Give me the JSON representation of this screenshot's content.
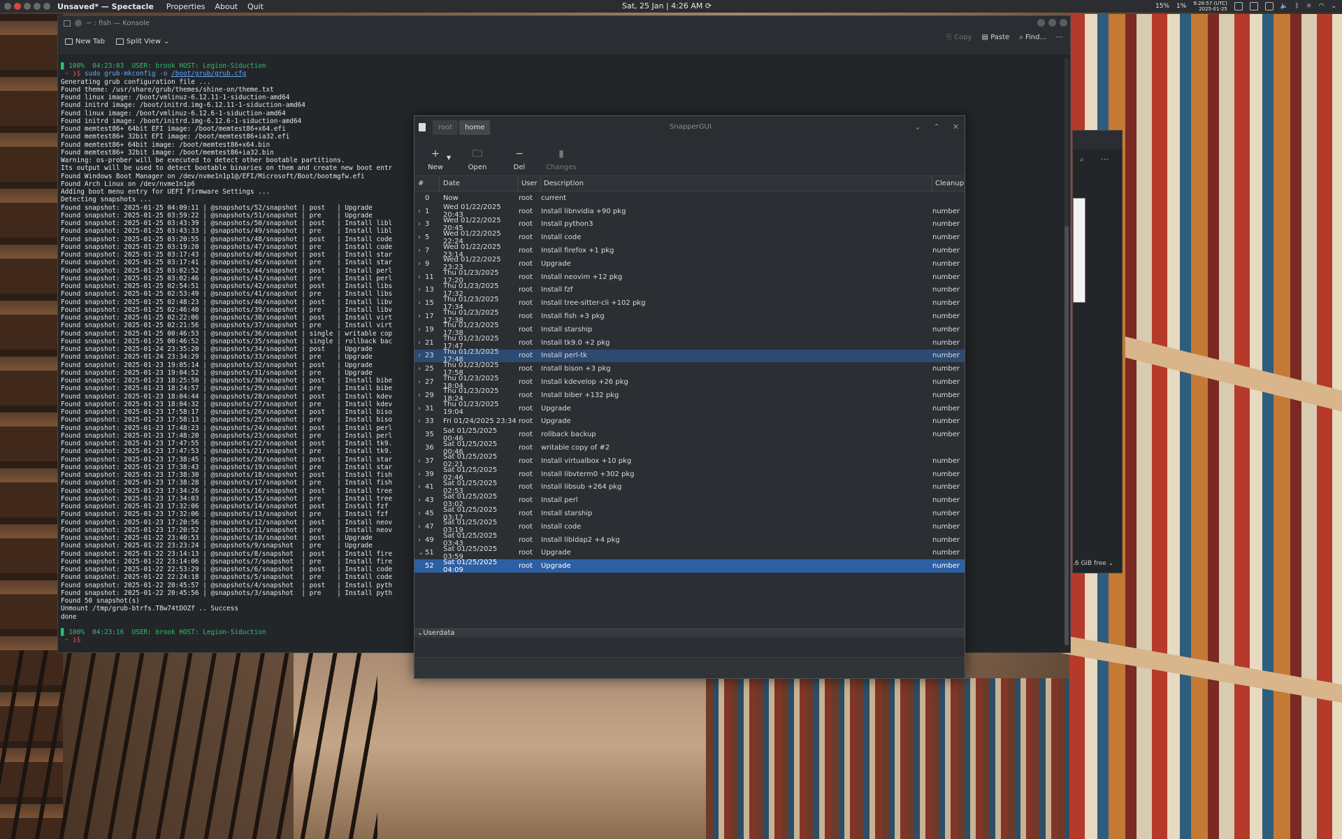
{
  "panel": {
    "app_title": "Unsaved* — Spectacle",
    "menu": [
      "Properties",
      "About",
      "Quit"
    ],
    "clock": "Sat, 25 Jan | 4:26 AM",
    "cpu": "15%",
    "mem": "1%",
    "time_utc": "9:26:57 (UTC)",
    "date_utc": "2025-01-25"
  },
  "konsole": {
    "title": "~ : fish — Konsole",
    "new_tab": "New Tab",
    "split_view": "Split View",
    "copy": "Copy",
    "paste": "Paste",
    "find": "Find...",
    "prompt1": "▊ 100%  04:23:03  USER: brook HOST: Legion-Siduction",
    "cmd_prefix": " ~ ❯$ ",
    "cmd_text": "sudo grub-mkconfig -o ",
    "cmd_path": "/boot/grub/grub.cfg",
    "output": "Generating grub configuration file ...\nFound theme: /usr/share/grub/themes/shine-on/theme.txt\nFound linux image: /boot/vmlinuz-6.12.11-1-siduction-amd64\nFound initrd image: /boot/initrd.img-6.12.11-1-siduction-amd64\nFound linux image: /boot/vmlinuz-6.12.6-1-siduction-amd64\nFound initrd image: /boot/initrd.img-6.12.6-1-siduction-amd64\nFound memtest86+ 64bit EFI image: /boot/memtest86+x64.efi\nFound memtest86+ 32bit EFI image: /boot/memtest86+ia32.efi\nFound memtest86+ 64bit image: /boot/memtest86+x64.bin\nFound memtest86+ 32bit image: /boot/memtest86+ia32.bin\nWarning: os-prober will be executed to detect other bootable partitions.\nIts output will be used to detect bootable binaries on them and create new boot entr\nFound Windows Boot Manager on /dev/nvme1n1p1@/EFI/Microsoft/Boot/bootmgfw.efi\nFound Arch Linux on /dev/nvme1n1p6\nAdding boot menu entry for UEFI Firmware Settings ...\nDetecting snapshots ...\nFound snapshot: 2025-01-25 04:09:11 | @snapshots/52/snapshot | post   | Upgrade\nFound snapshot: 2025-01-25 03:59:22 | @snapshots/51/snapshot | pre    | Upgrade\nFound snapshot: 2025-01-25 03:43:39 | @snapshots/50/snapshot | post   | Install libl\nFound snapshot: 2025-01-25 03:43:33 | @snapshots/49/snapshot | pre    | Install libl\nFound snapshot: 2025-01-25 03:20:55 | @snapshots/48/snapshot | post   | Install code\nFound snapshot: 2025-01-25 03:19:20 | @snapshots/47/snapshot | pre    | Install code\nFound snapshot: 2025-01-25 03:17:43 | @snapshots/46/snapshot | post   | Install star\nFound snapshot: 2025-01-25 03:17:41 | @snapshots/45/snapshot | pre    | Install star\nFound snapshot: 2025-01-25 03:02:52 | @snapshots/44/snapshot | post   | Install perl\nFound snapshot: 2025-01-25 03:02:46 | @snapshots/43/snapshot | pre    | Install perl\nFound snapshot: 2025-01-25 02:54:51 | @snapshots/42/snapshot | post   | Install libs\nFound snapshot: 2025-01-25 02:53:49 | @snapshots/41/snapshot | pre    | Install libs\nFound snapshot: 2025-01-25 02:48:23 | @snapshots/40/snapshot | post   | Install libv\nFound snapshot: 2025-01-25 02:46:40 | @snapshots/39/snapshot | pre    | Install libv\nFound snapshot: 2025-01-25 02:22:06 | @snapshots/38/snapshot | post   | Install virt\nFound snapshot: 2025-01-25 02:21:56 | @snapshots/37/snapshot | pre    | Install virt\nFound snapshot: 2025-01-25 00:46:53 | @snapshots/36/snapshot | single | writable cop\nFound snapshot: 2025-01-25 00:46:52 | @snapshots/35/snapshot | single | rollback bac\nFound snapshot: 2025-01-24 23:35:20 | @snapshots/34/snapshot | post   | Upgrade\nFound snapshot: 2025-01-24 23:34:29 | @snapshots/33/snapshot | pre    | Upgrade\nFound snapshot: 2025-01-23 19:05:14 | @snapshots/32/snapshot | post   | Upgrade\nFound snapshot: 2025-01-23 19:04:52 | @snapshots/31/snapshot | pre    | Upgrade\nFound snapshot: 2025-01-23 18:25:50 | @snapshots/30/snapshot | post   | Install bibe\nFound snapshot: 2025-01-23 18:24:57 | @snapshots/29/snapshot | pre    | Install bibe\nFound snapshot: 2025-01-23 18:04:44 | @snapshots/28/snapshot | post   | Install kdev\nFound snapshot: 2025-01-23 18:04:32 | @snapshots/27/snapshot | pre    | Install kdev\nFound snapshot: 2025-01-23 17:58:17 | @snapshots/26/snapshot | post   | Install biso\nFound snapshot: 2025-01-23 17:58:13 | @snapshots/25/snapshot | pre    | Install biso\nFound snapshot: 2025-01-23 17:48:23 | @snapshots/24/snapshot | post   | Install perl\nFound snapshot: 2025-01-23 17:48:20 | @snapshots/23/snapshot | pre    | Install perl\nFound snapshot: 2025-01-23 17:47:55 | @snapshots/22/snapshot | post   | Install tk9.\nFound snapshot: 2025-01-23 17:47:53 | @snapshots/21/snapshot | pre    | Install tk9.\nFound snapshot: 2025-01-23 17:38:45 | @snapshots/20/snapshot | post   | Install star\nFound snapshot: 2025-01-23 17:38:43 | @snapshots/19/snapshot | pre    | Install star\nFound snapshot: 2025-01-23 17:38:30 | @snapshots/18/snapshot | post   | Install fish\nFound snapshot: 2025-01-23 17:38:28 | @snapshots/17/snapshot | pre    | Install fish\nFound snapshot: 2025-01-23 17:34:26 | @snapshots/16/snapshot | post   | Install tree\nFound snapshot: 2025-01-23 17:34:03 | @snapshots/15/snapshot | pre    | Install tree\nFound snapshot: 2025-01-23 17:32:06 | @snapshots/14/snapshot | post   | Install fzf\nFound snapshot: 2025-01-23 17:32:06 | @snapshots/13/snapshot | pre    | Install fzf\nFound snapshot: 2025-01-23 17:20:56 | @snapshots/12/snapshot | post   | Install neov\nFound snapshot: 2025-01-23 17:20:52 | @snapshots/11/snapshot | pre    | Install neov\nFound snapshot: 2025-01-22 23:40:53 | @snapshots/10/snapshot | post   | Upgrade\nFound snapshot: 2025-01-22 23:23:24 | @snapshots/9/snapshot  | pre    | Upgrade\nFound snapshot: 2025-01-22 23:14:13 | @snapshots/8/snapshot  | post   | Install fire\nFound snapshot: 2025-01-22 23:14:06 | @snapshots/7/snapshot  | pre    | Install fire\nFound snapshot: 2025-01-22 22:53:29 | @snapshots/6/snapshot  | post   | Install code\nFound snapshot: 2025-01-22 22:24:18 | @snapshots/5/snapshot  | pre    | Install code\nFound snapshot: 2025-01-22 20:45:57 | @snapshots/4/snapshot  | post   | Install pyth\nFound snapshot: 2025-01-22 20:45:56 | @snapshots/3/snapshot  | pre    | Install pyth\nFound 50 snapshot(s)\nUnmount /tmp/grub-btrfs.T8w74tDOZf .. Success\ndone",
    "prompt2": "▊ 100%  04:23:16  USER: brook HOST: Legion-Siduction",
    "cmd_prefix2": " ~ ❯$ "
  },
  "back_window": {
    "free_label": ".6 GiB free ⌄"
  },
  "snapper": {
    "title": "SnapperGUI",
    "tabs": [
      "root",
      "home"
    ],
    "toolbar": {
      "new": "New",
      "open": "Open",
      "del": "Del",
      "changes": "Changes"
    },
    "headers": {
      "num": "#",
      "date": "Date",
      "user": "User",
      "desc": "Description",
      "cleanup": "Cleanup"
    },
    "rows": [
      {
        "num": "0",
        "date": "Now",
        "user": "root",
        "desc": "current",
        "cleanup": "",
        "expand": false
      },
      {
        "num": "1",
        "date": "Wed 01/22/2025 20:43",
        "user": "root",
        "desc": "Install libnvidia +90 pkg",
        "cleanup": "number",
        "expand": true
      },
      {
        "num": "3",
        "date": "Wed 01/22/2025 20:45",
        "user": "root",
        "desc": "Install python3",
        "cleanup": "number",
        "expand": true
      },
      {
        "num": "5",
        "date": "Wed 01/22/2025 22:24",
        "user": "root",
        "desc": "Install code",
        "cleanup": "number",
        "expand": true
      },
      {
        "num": "7",
        "date": "Wed 01/22/2025 23:14",
        "user": "root",
        "desc": "Install firefox +1 pkg",
        "cleanup": "number",
        "expand": true
      },
      {
        "num": "9",
        "date": "Wed 01/22/2025 23:23",
        "user": "root",
        "desc": "Upgrade",
        "cleanup": "number",
        "expand": true
      },
      {
        "num": "11",
        "date": "Thu 01/23/2025 17:20",
        "user": "root",
        "desc": "Install neovim +12 pkg",
        "cleanup": "number",
        "expand": true
      },
      {
        "num": "13",
        "date": "Thu 01/23/2025 17:32",
        "user": "root",
        "desc": "Install fzf",
        "cleanup": "number",
        "expand": true
      },
      {
        "num": "15",
        "date": "Thu 01/23/2025 17:34",
        "user": "root",
        "desc": "Install tree-sitter-cli +102 pkg",
        "cleanup": "number",
        "expand": true
      },
      {
        "num": "17",
        "date": "Thu 01/23/2025 17:38",
        "user": "root",
        "desc": "Install fish +3 pkg",
        "cleanup": "number",
        "expand": true
      },
      {
        "num": "19",
        "date": "Thu 01/23/2025 17:38",
        "user": "root",
        "desc": "Install starship",
        "cleanup": "number",
        "expand": true
      },
      {
        "num": "21",
        "date": "Thu 01/23/2025 17:47",
        "user": "root",
        "desc": "Install tk9.0 +2 pkg",
        "cleanup": "number",
        "expand": true
      },
      {
        "num": "23",
        "date": "Thu 01/23/2025 17:48",
        "user": "root",
        "desc": "Install perl-tk",
        "cleanup": "number",
        "expand": true,
        "selected": "hover"
      },
      {
        "num": "25",
        "date": "Thu 01/23/2025 17:58",
        "user": "root",
        "desc": "Install bison +3 pkg",
        "cleanup": "number",
        "expand": true
      },
      {
        "num": "27",
        "date": "Thu 01/23/2025 18:04",
        "user": "root",
        "desc": "Install kdevelop +26 pkg",
        "cleanup": "number",
        "expand": true
      },
      {
        "num": "29",
        "date": "Thu 01/23/2025 18:24",
        "user": "root",
        "desc": "Install biber +132 pkg",
        "cleanup": "number",
        "expand": true
      },
      {
        "num": "31",
        "date": "Thu 01/23/2025 19:04",
        "user": "root",
        "desc": "Upgrade",
        "cleanup": "number",
        "expand": true
      },
      {
        "num": "33",
        "date": "Fri 01/24/2025 23:34",
        "user": "root",
        "desc": "Upgrade",
        "cleanup": "number",
        "expand": true
      },
      {
        "num": "35",
        "date": "Sat 01/25/2025 00:46",
        "user": "root",
        "desc": "rollback backup",
        "cleanup": "number",
        "expand": false
      },
      {
        "num": "36",
        "date": "Sat 01/25/2025 00:46",
        "user": "root",
        "desc": "writable copy of #2",
        "cleanup": "",
        "expand": false
      },
      {
        "num": "37",
        "date": "Sat 01/25/2025 02:21",
        "user": "root",
        "desc": "Install virtualbox +10 pkg",
        "cleanup": "number",
        "expand": true
      },
      {
        "num": "39",
        "date": "Sat 01/25/2025 02:46",
        "user": "root",
        "desc": "Install libvterm0 +302 pkg",
        "cleanup": "number",
        "expand": true
      },
      {
        "num": "41",
        "date": "Sat 01/25/2025 02:53",
        "user": "root",
        "desc": "Install libsub +264 pkg",
        "cleanup": "number",
        "expand": true
      },
      {
        "num": "43",
        "date": "Sat 01/25/2025 03:02",
        "user": "root",
        "desc": "Install perl",
        "cleanup": "number",
        "expand": true
      },
      {
        "num": "45",
        "date": "Sat 01/25/2025 03:17",
        "user": "root",
        "desc": "Install starship",
        "cleanup": "number",
        "expand": true
      },
      {
        "num": "47",
        "date": "Sat 01/25/2025 03:19",
        "user": "root",
        "desc": "Install code",
        "cleanup": "number",
        "expand": true
      },
      {
        "num": "49",
        "date": "Sat 01/25/2025 03:43",
        "user": "root",
        "desc": "Install libldap2 +4 pkg",
        "cleanup": "number",
        "expand": true
      },
      {
        "num": "51",
        "date": "Sat 01/25/2025 03:59",
        "user": "root",
        "desc": "Upgrade",
        "cleanup": "number",
        "expand": "open"
      },
      {
        "num": "52",
        "date": "Sat 01/25/2025 04:09",
        "user": "root",
        "desc": "Upgrade",
        "cleanup": "number",
        "expand": false,
        "selected": "active"
      }
    ],
    "userdata_label": "Userdata"
  }
}
